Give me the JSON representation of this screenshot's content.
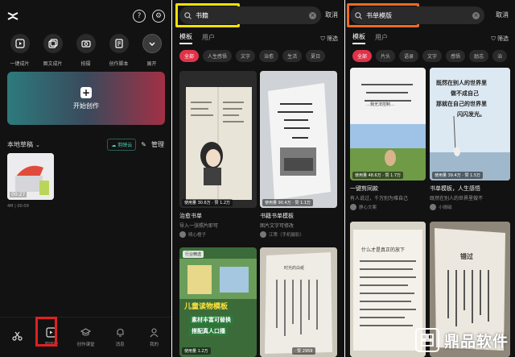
{
  "left": {
    "tools": [
      {
        "label": "一键成片",
        "icon": "play-square-icon"
      },
      {
        "label": "图文成片",
        "icon": "image-stack-icon"
      },
      {
        "label": "拍摄",
        "icon": "camera-icon"
      },
      {
        "label": "创作脚本",
        "icon": "script-icon"
      },
      {
        "label": "展开",
        "icon": "chevron-down-icon"
      }
    ],
    "banner_label": "开始创作",
    "drafts_title": "本地草稿",
    "cloud_label": "剪映云",
    "manage_label": "管理",
    "draft_duration": "00:27",
    "draft_meta": "4M | 00:09",
    "tabbar": [
      {
        "label": "",
        "icon": "scissors-icon"
      },
      {
        "label": "剪同款",
        "icon": "template-icon"
      },
      {
        "label": "创作课堂",
        "icon": "grad-cap-icon"
      },
      {
        "label": "消息",
        "icon": "bell-icon"
      },
      {
        "label": "我的",
        "icon": "user-icon"
      }
    ]
  },
  "middle": {
    "query": "书籍",
    "cancel": "取消",
    "tab_active": "模板",
    "tab_other": "用户",
    "filter": "筛选",
    "chips": [
      "全部",
      "人生感悟",
      "文字",
      "治愈",
      "生活",
      "夏日"
    ],
    "cards": [
      {
        "stats": "使用量 30.6万 · 赞 1.2万",
        "title": "治愈书单",
        "subtitle": "导入一张照片即可",
        "author": "晴心橙子"
      },
      {
        "stats": "使用量 90.4万 · 赞 1.1万",
        "title": "书籍书单模板",
        "subtitle": "图片文字可修改",
        "author": "江策（手机摄影）"
      },
      {
        "badge": "行业精选",
        "big1": "儿童读物模板",
        "big2": "素材丰富可替换",
        "big3": "搭配真人口播",
        "stats": "使用量 1.2万"
      },
      {
        "stats": "· 赞 2959",
        "page_text": "时光的白纸"
      }
    ]
  },
  "right": {
    "query": "书单模版",
    "cancel": "取消",
    "tab_active": "模板",
    "tab_other": "用户",
    "filter": "筛选",
    "chips": [
      "全部",
      "片头",
      "语录",
      "文字",
      "感悟",
      "励志",
      "治"
    ],
    "cards": [
      {
        "stats": "使用量 48.6万 · 赞 1.7万",
        "title": "一键剪同款",
        "subtitle": "有人说过，千万别为难自己",
        "author": "静心文案"
      },
      {
        "stats": "使用量 39.4万 · 赞 1.5万",
        "title": "书单模板，人生感悟",
        "subtitle": "既然在别人的世界里做不",
        "author": "小婧磁"
      },
      {
        "stats": "",
        "title": "",
        "subtitle": "",
        "author": ""
      },
      {
        "stats": "",
        "title": "错过",
        "subtitle": "",
        "author": ""
      }
    ],
    "quote_card1": "…我无法控制…",
    "quote_card2_l1": "既然在别人的世界里",
    "quote_card2_l2": "做不成自己",
    "quote_card2_l3": "那就在自己的世界里",
    "quote_card2_l4": "闪闪发光。",
    "page_heading": "什么才是真正的放下"
  },
  "watermark": "鼎品软件",
  "colors": {
    "accent_red": "#e0334a",
    "yellow_box": "#f3e000",
    "orange_box": "#ec6a22",
    "red_box": "#e02020"
  }
}
